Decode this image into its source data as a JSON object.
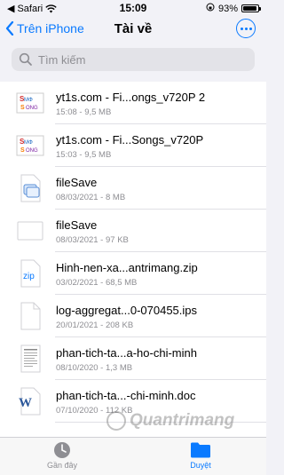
{
  "status": {
    "carrier": "Safari",
    "time": "15:09",
    "battery": "93%",
    "battery_level": 0.93
  },
  "nav": {
    "back_label": "Trên iPhone",
    "title": "Tài về"
  },
  "search": {
    "placeholder": "Tìm kiếm"
  },
  "files": [
    {
      "name": "yt1s.com - Fi...ongs_v720P 2",
      "meta": "15:08 - 9,5 MB",
      "icon": "video-thumbnail-icon"
    },
    {
      "name": "yt1s.com - Fi...Songs_v720P",
      "meta": "15:03 - 9,5 MB",
      "icon": "video-thumbnail-icon"
    },
    {
      "name": "fileSave",
      "meta": "08/03/2021 - 8 MB",
      "icon": "file-save-icon"
    },
    {
      "name": "fileSave",
      "meta": "08/03/2021 - 97 KB",
      "icon": "blank-file-icon"
    },
    {
      "name": "Hinh-nen-xa...antrimang.zip",
      "meta": "03/02/2021 - 68,5 MB",
      "icon": "zip-file-icon"
    },
    {
      "name": "log-aggregat...0-070455.ips",
      "meta": "20/01/2021 - 208 KB",
      "icon": "document-icon"
    },
    {
      "name": "phan-tich-ta...a-ho-chi-minh",
      "meta": "08/10/2020 - 1,3 MB",
      "icon": "document-preview-icon"
    },
    {
      "name": "phan-tich-ta...-chi-minh.doc",
      "meta": "07/10/2020 - 112 KB",
      "icon": "word-document-icon"
    }
  ],
  "tabs": [
    {
      "label": "Gần đây",
      "icon": "clock-icon",
      "active": false
    },
    {
      "label": "Duyệt",
      "icon": "folder-icon",
      "active": true
    }
  ],
  "watermark": "Quantrimang",
  "colors": {
    "accent": "#0a7aff",
    "secondary_text": "#8e8e93",
    "background": "#f2f2f7"
  }
}
